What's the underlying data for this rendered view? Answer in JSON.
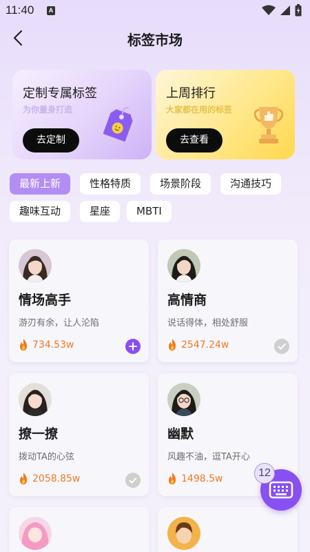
{
  "status_bar": {
    "time": "11:40",
    "a_label": "A"
  },
  "header": {
    "title": "标签市场"
  },
  "promos": [
    {
      "title": "定制专属标签",
      "subtitle": "为你量身打造",
      "button": "去定制"
    },
    {
      "title": "上周排行",
      "subtitle": "大家都在用的标签",
      "button": "去查看"
    }
  ],
  "categories": [
    {
      "label": "最新上新",
      "active": true
    },
    {
      "label": "性格特质",
      "active": false
    },
    {
      "label": "场景阶段",
      "active": false
    },
    {
      "label": "沟通技巧",
      "active": false
    },
    {
      "label": "趣味互动",
      "active": false
    },
    {
      "label": "星座",
      "active": false
    },
    {
      "label": "MBTI",
      "active": false
    }
  ],
  "cards": [
    {
      "title": "情场高手",
      "desc": "游刃有余，让人沦陷",
      "popularity": "734.53w",
      "added": false
    },
    {
      "title": "高情商",
      "desc": "说话得体，相处舒服",
      "popularity": "2547.24w",
      "added": true
    },
    {
      "title": "撩一撩",
      "desc": "拨动TA的心弦",
      "popularity": "2058.85w",
      "added": true
    },
    {
      "title": "幽默",
      "desc": "风趣不油，逗TA开心",
      "popularity": "1498.5w",
      "added": false
    }
  ],
  "fab": {
    "badge": "12",
    "icon": "keyboard-icon"
  },
  "colors": {
    "accent": "#8a4ff0",
    "chip_active": "#b38df3",
    "popularity": "#ef7a22"
  }
}
